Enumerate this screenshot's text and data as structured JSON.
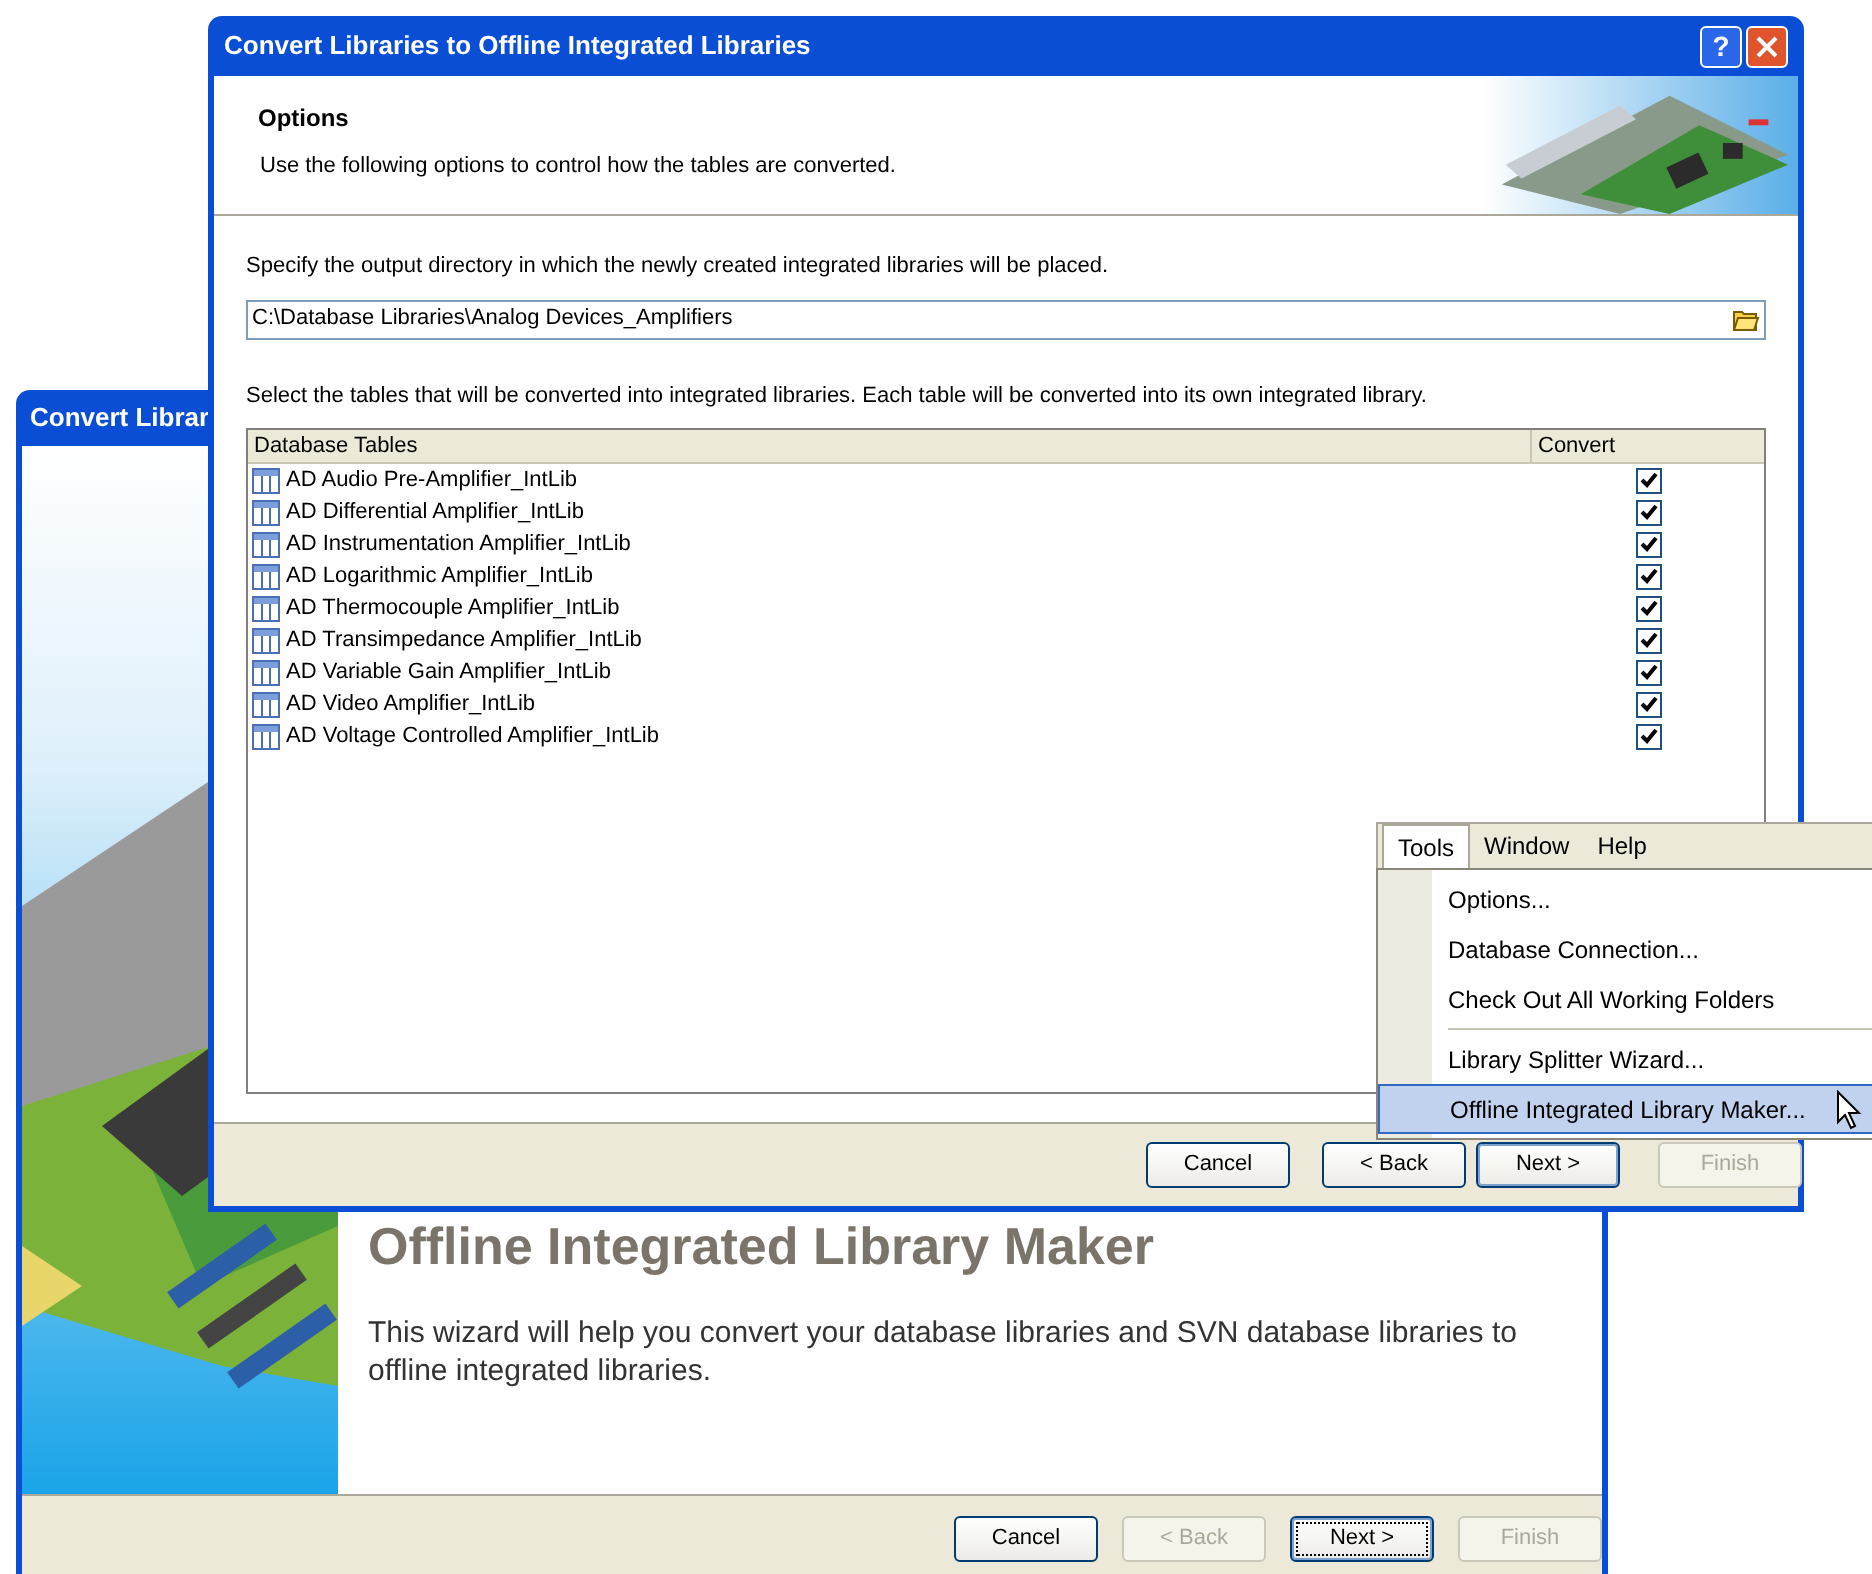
{
  "back_window": {
    "title": "Convert Librar",
    "heading": "Offline Integrated Library Maker",
    "description": "This wizard will help you convert your database libraries and SVN database libraries to offline integrated libraries.",
    "buttons": [
      {
        "label": "Cancel",
        "disabled": false,
        "default": false,
        "focused": false
      },
      {
        "label": "< Back",
        "disabled": true,
        "default": false,
        "focused": false
      },
      {
        "label": "Next >",
        "disabled": false,
        "default": true,
        "focused": true
      },
      {
        "label": "Finish",
        "disabled": true,
        "default": false,
        "focused": false
      }
    ]
  },
  "front_window": {
    "title": "Convert Libraries to Offline Integrated Libraries",
    "help_glyph": "?",
    "header": {
      "title": "Options",
      "subtitle": "Use the following options to control how the tables are converted."
    },
    "output_prompt": "Specify the output directory in which the newly created integrated libraries will be placed.",
    "output_directory": "C:\\Database Libraries\\Analog Devices_Amplifiers",
    "tables_prompt": "Select the tables that will be converted into integrated libraries. Each table will be converted into its own integrated library.",
    "table": {
      "columns": [
        "Database Tables",
        "Convert"
      ],
      "rows": [
        {
          "name": "AD Audio Pre-Amplifier_IntLib",
          "checked": true
        },
        {
          "name": "AD Differential Amplifier_IntLib",
          "checked": true
        },
        {
          "name": "AD Instrumentation Amplifier_IntLib",
          "checked": true
        },
        {
          "name": "AD Logarithmic Amplifier_IntLib",
          "checked": true
        },
        {
          "name": "AD Thermocouple Amplifier_IntLib",
          "checked": true
        },
        {
          "name": "AD Transimpedance Amplifier_IntLib",
          "checked": true
        },
        {
          "name": "AD Variable Gain Amplifier_IntLib",
          "checked": true
        },
        {
          "name": "AD Video Amplifier_IntLib",
          "checked": true
        },
        {
          "name": "AD Voltage Controlled Amplifier_IntLib",
          "checked": true
        }
      ]
    },
    "buttons": [
      {
        "label": "Cancel",
        "disabled": false,
        "default": false,
        "focused": false
      },
      {
        "label": "< Back",
        "disabled": false,
        "default": false,
        "focused": false
      },
      {
        "label": "Next >",
        "disabled": false,
        "default": true,
        "focused": false
      },
      {
        "label": "Finish",
        "disabled": true,
        "default": false,
        "focused": false
      }
    ]
  },
  "menu": {
    "menus": [
      {
        "label": "Tools",
        "selected": true
      },
      {
        "label": "Window",
        "selected": false
      },
      {
        "label": "Help",
        "selected": false
      }
    ],
    "items": [
      {
        "kind": "item",
        "label": "Options...",
        "selected": false
      },
      {
        "kind": "item",
        "label": "Database Connection...",
        "selected": false
      },
      {
        "kind": "item",
        "label": "Check Out All Working Folders",
        "selected": false
      },
      {
        "kind": "separator"
      },
      {
        "kind": "item",
        "label": "Library Splitter Wizard...",
        "selected": false
      },
      {
        "kind": "item",
        "label": "Offline Integrated Library Maker...",
        "selected": true
      }
    ]
  }
}
